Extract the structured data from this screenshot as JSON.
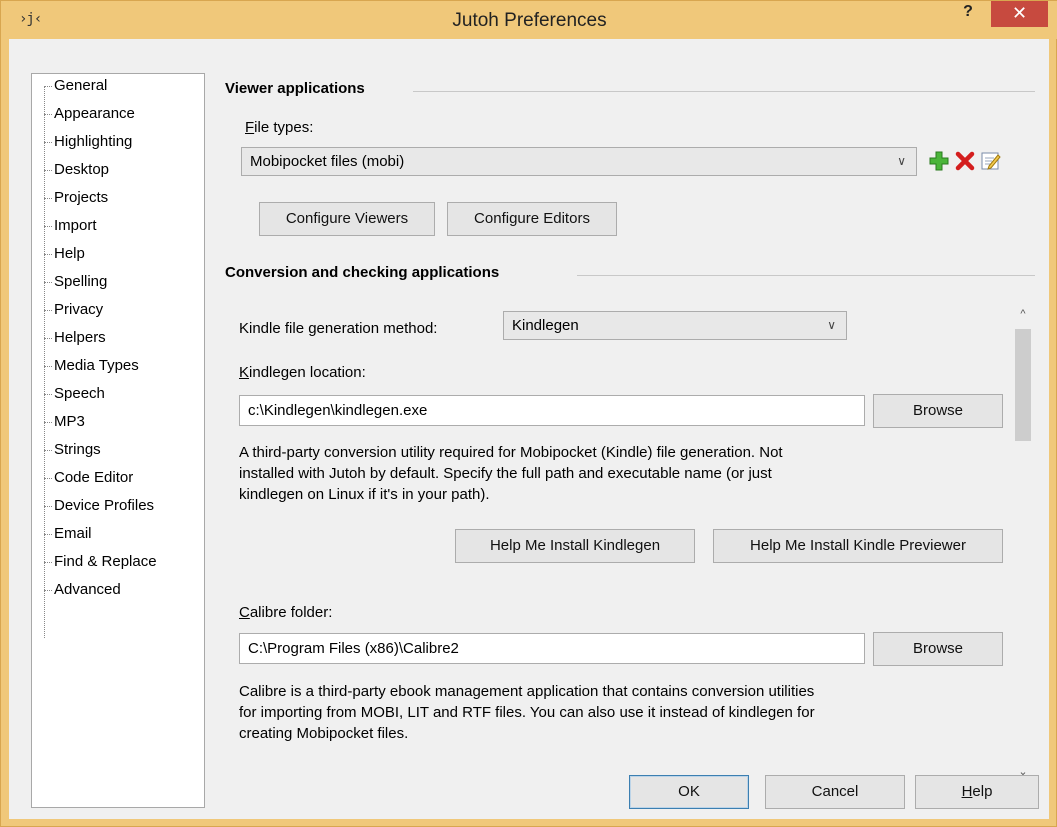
{
  "window": {
    "title": "Jutoh Preferences",
    "help_glyph": "?",
    "close_glyph": "✕",
    "app_icon_glyph": "›j‹"
  },
  "tree": {
    "items": [
      "General",
      "Appearance",
      "Highlighting",
      "Desktop",
      "Projects",
      "Import",
      "Help",
      "Spelling",
      "Privacy",
      "Helpers",
      "Media Types",
      "Speech",
      "MP3",
      "Strings",
      "Code Editor",
      "Device Profiles",
      "Email",
      "Find & Replace",
      "Advanced"
    ],
    "selected": "Helpers"
  },
  "viewer": {
    "section_title": "Viewer applications",
    "file_types_label_first": "F",
    "file_types_label_rest": "ile types:",
    "file_type_value": "Mobipocket files (mobi)",
    "configure_viewers": "Configure Viewers",
    "configure_editors": "Configure Editors",
    "add_icon": "add-icon",
    "delete_icon": "delete-icon",
    "edit_icon": "edit-icon"
  },
  "conversion": {
    "section_title": "Conversion and checking applications",
    "kindle_method_label": "Kindle file generation method:",
    "kindle_method_value": "Kindlegen",
    "kindlegen_loc_label_first": "K",
    "kindlegen_loc_label_rest": "indlegen location:",
    "kindlegen_path": "c:\\Kindlegen\\kindlegen.exe",
    "browse1": "Browse",
    "kindlegen_desc_1": "A third-party conversion utility required for Mobipocket (Kindle) file generation. Not",
    "kindlegen_desc_2": "installed with Jutoh by default. Specify the full path and executable name (or just",
    "kindlegen_desc_3": "kindlegen on Linux if it's in your path).",
    "help_install_kindlegen": "Help Me Install Kindlegen",
    "help_install_previewer": "Help Me Install Kindle Previewer",
    "calibre_label_first": "C",
    "calibre_label_rest": "alibre folder:",
    "calibre_path": "C:\\Program Files (x86)\\Calibre2",
    "browse2": "Browse",
    "calibre_desc_1": "Calibre is a third-party ebook management application that contains conversion utilities",
    "calibre_desc_2": "for importing from MOBI, LIT and RTF files. You can also use it instead of kindlegen for",
    "calibre_desc_3": "creating Mobipocket files."
  },
  "footer": {
    "ok": "OK",
    "cancel": "Cancel",
    "help_first": "H",
    "help_rest": "elp"
  },
  "colors": {
    "titlebar": "#f0c87a",
    "close": "#c74a3f",
    "dialog_bg": "#f0f0f0"
  }
}
